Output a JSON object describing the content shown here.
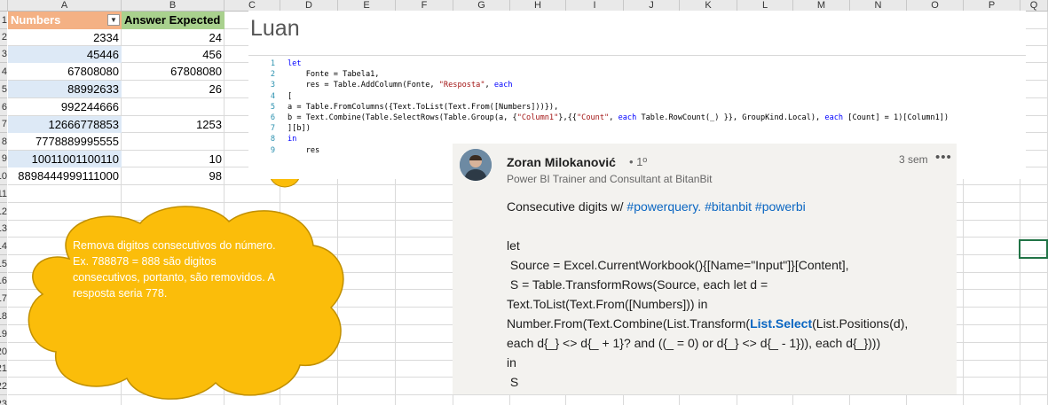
{
  "sheet": {
    "columns": [
      "A",
      "B",
      "C",
      "D",
      "E",
      "F",
      "G",
      "H",
      "I",
      "J",
      "K",
      "L",
      "M",
      "N",
      "O",
      "P",
      "Q"
    ],
    "rows": [
      "1",
      "2",
      "3",
      "4",
      "5",
      "6",
      "7",
      "8",
      "9",
      "10",
      "11",
      "12",
      "13",
      "14",
      "15",
      "16",
      "17",
      "18",
      "19",
      "20",
      "21",
      "22",
      "23"
    ],
    "table": {
      "header_numbers": "Numbers",
      "header_answer": "Answer Expected",
      "filter_icon": "dropdown-arrow-icon",
      "rows": [
        {
          "number": "2334",
          "answer": "24"
        },
        {
          "number": "45446",
          "answer": "456"
        },
        {
          "number": "67808080",
          "answer": "67808080"
        },
        {
          "number": "88992633",
          "answer": "26"
        },
        {
          "number": "992244666",
          "answer": ""
        },
        {
          "number": "12666778853",
          "answer": "1253"
        },
        {
          "number": "7778889995555",
          "answer": ""
        },
        {
          "number": "10011001100110",
          "answer": "10"
        },
        {
          "number": "8898444999111000",
          "answer": "98"
        }
      ]
    },
    "colors": {
      "header_a": "#f4b184",
      "header_b": "#a9d18e",
      "band": "#dde9f6",
      "selection": "#217346"
    }
  },
  "callout": {
    "text": "Remova digitos consecutivos do número. Ex. 788878 = 888 são digitos consecutivos, portanto, são removidos. A resposta seria 778.",
    "color": "#fbbd0a"
  },
  "editor": {
    "title": "Luan",
    "lines": [
      {
        "n": "1",
        "code": "let"
      },
      {
        "n": "2",
        "code": "    Fonte = Tabela1,"
      },
      {
        "n": "3",
        "code": "    res = Table.AddColumn(Fonte, \"Resposta\", each"
      },
      {
        "n": "4",
        "code": "["
      },
      {
        "n": "5",
        "code": "a = Table.FromColumns({Text.ToList(Text.From([Numbers]))}),"
      },
      {
        "n": "6",
        "code": "b = Text.Combine(Table.SelectRows(Table.Group(a, {\"Column1\"},{{\"Count\", each Table.RowCount(_) }}, GroupKind.Local), each [Count] = 1)[Column1])"
      },
      {
        "n": "7",
        "code": "][b])"
      },
      {
        "n": "8",
        "code": "in"
      },
      {
        "n": "9",
        "code": "    res"
      }
    ]
  },
  "comment": {
    "author": "Zoran Milokanović",
    "degree": "• 1º",
    "time": "3 sem",
    "more_icon": "more-options-icon",
    "headline": "Power BI Trainer and Consultant at BitanBit",
    "intro": "Consecutive digits w/ ",
    "hashtags": "#powerquery. #bitanbit #powerbi",
    "code_lines": [
      "let",
      " Source = Excel.CurrentWorkbook(){[Name=\"Input\"]}[Content],",
      " S = Table.TransformRows(Source, each let d =",
      "Text.ToList(Text.From([Numbers])) in",
      "Number.From(Text.Combine(List.Transform(|List.Select|(List.Positions(d),",
      "each d{_} <> d{_ + 1}? and ((_ = 0) or d{_} <> d{_ - 1})), each d{_})))",
      "in",
      " S"
    ]
  }
}
